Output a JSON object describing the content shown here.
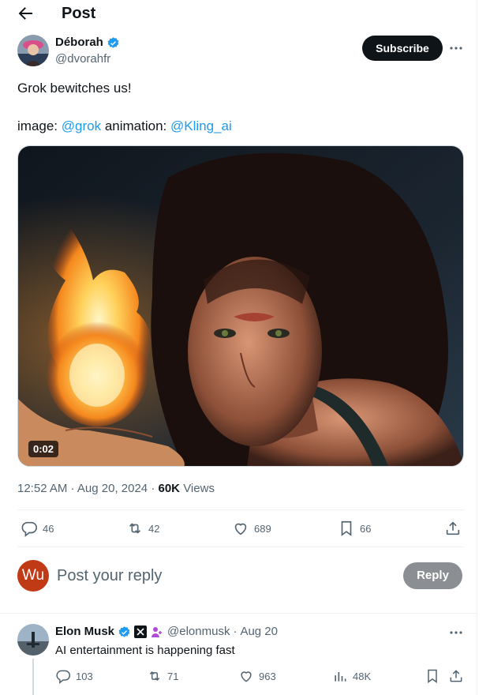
{
  "header": {
    "title": "Post"
  },
  "author": {
    "name": "Déborah",
    "handle": "@dvorahfr",
    "subscribe_label": "Subscribe"
  },
  "tweet": {
    "line1": "Grok bewitches us!",
    "image_label": "image:",
    "image_mention": "@grok",
    "animation_label": "animation:",
    "animation_mention": "@Kling_ai"
  },
  "media": {
    "duration": "0:02"
  },
  "meta": {
    "time": "12:52 AM",
    "date": "Aug 20, 2024",
    "views_count": "60K",
    "views_label": "Views"
  },
  "actions": {
    "replies": "46",
    "reposts": "42",
    "likes": "689",
    "bookmarks": "66"
  },
  "composer": {
    "avatar_initials": "Wu",
    "placeholder": "Post your reply",
    "reply_label": "Reply"
  },
  "reply": {
    "name": "Elon Musk",
    "handle": "@elonmusk",
    "date": "Aug 20",
    "text": "AI entertainment is happening fast",
    "stats": {
      "replies": "103",
      "reposts": "71",
      "likes": "963",
      "views": "48K"
    }
  },
  "colors": {
    "accent": "#1d9bf0",
    "text": "#0f1419",
    "muted": "#536471",
    "subscribe_bg": "#0f1419",
    "reply_button_bg": "#8b8f93",
    "composer_avatar_bg": "#c13a16"
  },
  "icons": [
    "back-arrow-icon",
    "verified-badge-icon",
    "more-icon",
    "reply-icon",
    "repost-icon",
    "like-icon",
    "bookmark-icon",
    "share-icon",
    "x-logo-icon",
    "affiliate-badge-icon",
    "views-icon"
  ]
}
